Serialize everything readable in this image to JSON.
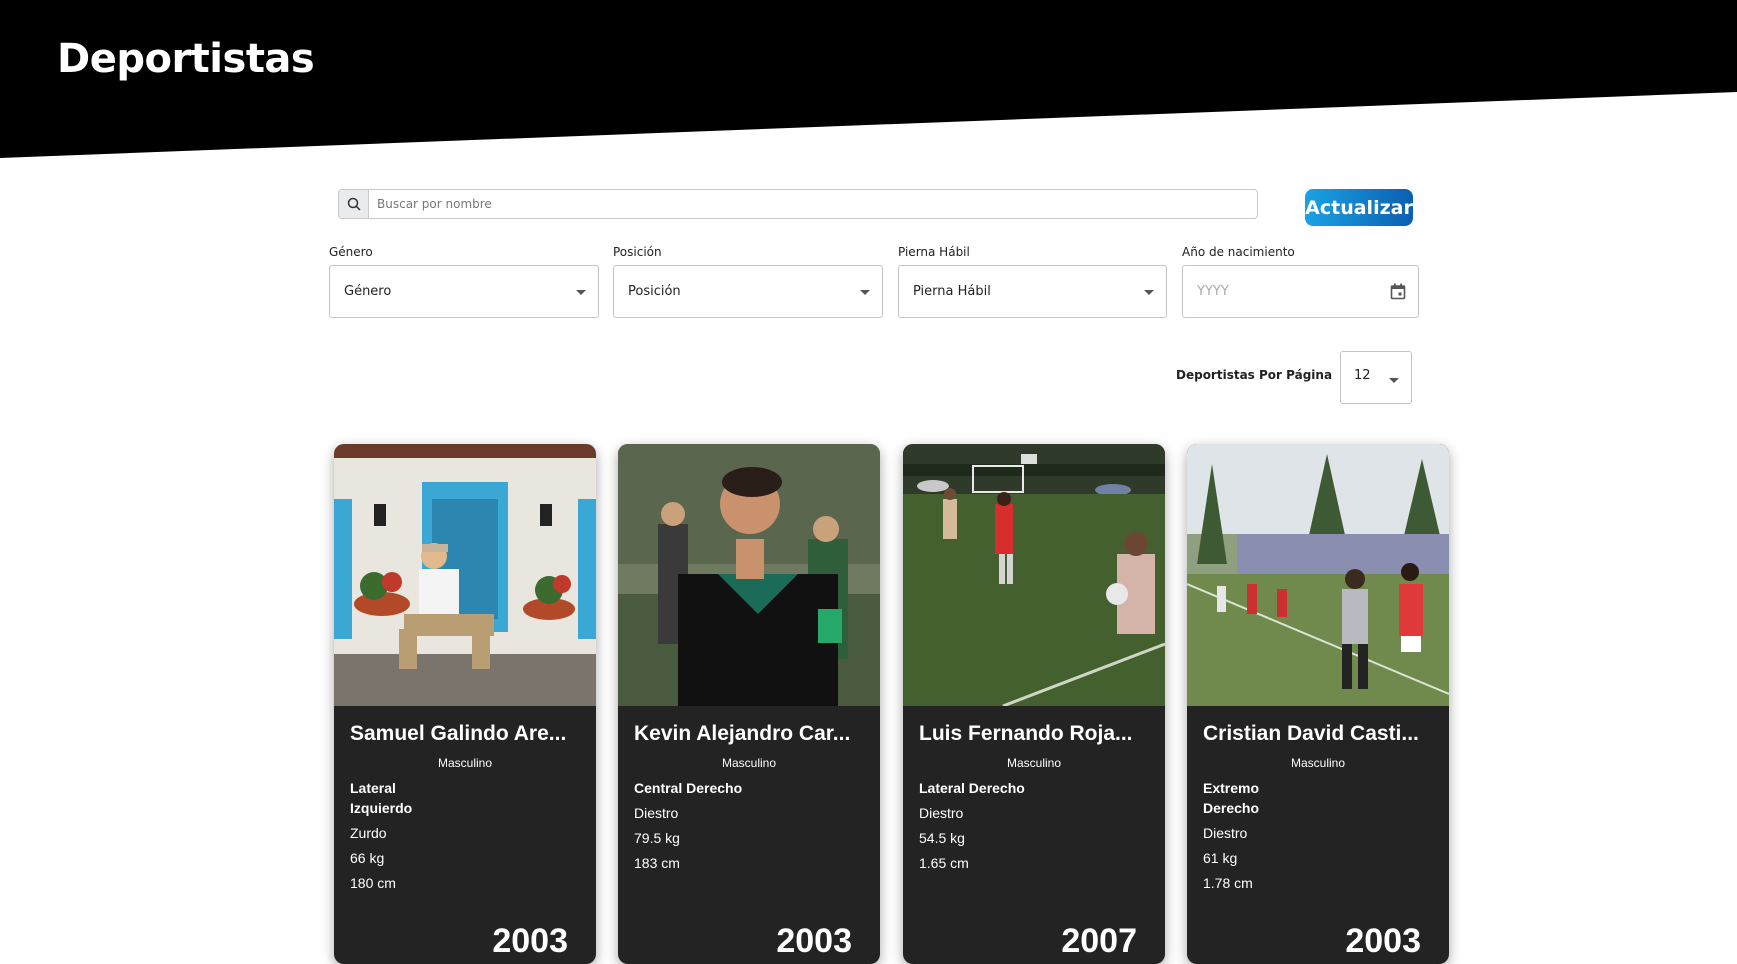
{
  "page": {
    "title": "Deportistas"
  },
  "search": {
    "placeholder": "Buscar por nombre",
    "button_label": "Actualizar"
  },
  "filters": [
    {
      "label": "Género",
      "value": "Género"
    },
    {
      "label": "Posición",
      "value": "Posición"
    },
    {
      "label": "Pierna Hábil",
      "value": "Pierna Hábil"
    },
    {
      "label": "Año de nacimiento",
      "placeholder": "YYYY"
    }
  ],
  "pagination": {
    "label": "Deportistas Por Página",
    "value": "12"
  },
  "athletes": [
    {
      "name": "Samuel Galindo Are...",
      "gender": "Masculino",
      "position": "Lateral Izquierdo",
      "foot": "Zurdo",
      "weight": "66 kg",
      "height": "180 cm",
      "year": "2003"
    },
    {
      "name": "Kevin Alejandro Car...",
      "gender": "Masculino",
      "position": "Central Derecho",
      "foot": "Diestro",
      "weight": "79.5 kg",
      "height": "183 cm",
      "year": "2003"
    },
    {
      "name": "Luis Fernando Roja...",
      "gender": "Masculino",
      "position": "Lateral Derecho",
      "foot": "Diestro",
      "weight": "54.5 kg",
      "height": "1.65 cm",
      "year": "2007"
    },
    {
      "name": "Cristian David Casti...",
      "gender": "Masculino",
      "position": "Extremo Derecho",
      "foot": "Diestro",
      "weight": "61 kg",
      "height": "1.78 cm",
      "year": "2003"
    }
  ]
}
